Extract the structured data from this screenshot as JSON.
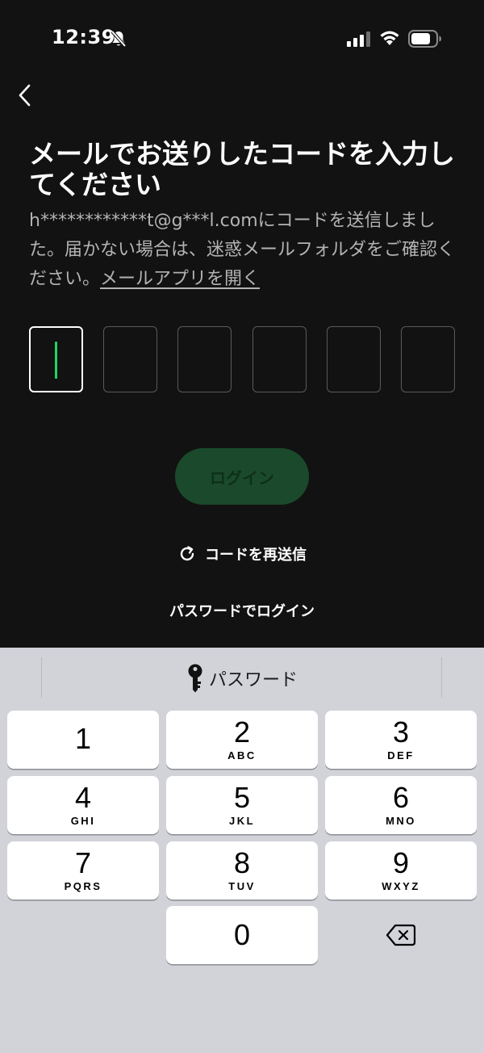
{
  "status": {
    "time": "12:39"
  },
  "title": "メールでお送りしたコードを入力してください",
  "description": {
    "text": "h************t@g***l.comにコードを送信しました。届かない場合は、迷惑メールフォルダをご確認ください。",
    "link": "メールアプリを開く"
  },
  "code_boxes": [
    "",
    "",
    "",
    "",
    "",
    ""
  ],
  "login_button": "ログイン",
  "resend": "コードを再送信",
  "password_login": "パスワードでログイン",
  "keyboard": {
    "suggestion": "パスワード",
    "keys": [
      {
        "num": "1",
        "letters": ""
      },
      {
        "num": "2",
        "letters": "ABC"
      },
      {
        "num": "3",
        "letters": "DEF"
      },
      {
        "num": "4",
        "letters": "GHI"
      },
      {
        "num": "5",
        "letters": "JKL"
      },
      {
        "num": "6",
        "letters": "MNO"
      },
      {
        "num": "7",
        "letters": "PQRS"
      },
      {
        "num": "8",
        "letters": "TUV"
      },
      {
        "num": "9",
        "letters": "WXYZ"
      },
      {
        "num": "0",
        "letters": ""
      }
    ]
  },
  "colors": {
    "background": "#121212",
    "accent_green": "#1ed760",
    "login_button_bg": "#1a4a2b",
    "keyboard_bg": "#d1d3d9"
  }
}
